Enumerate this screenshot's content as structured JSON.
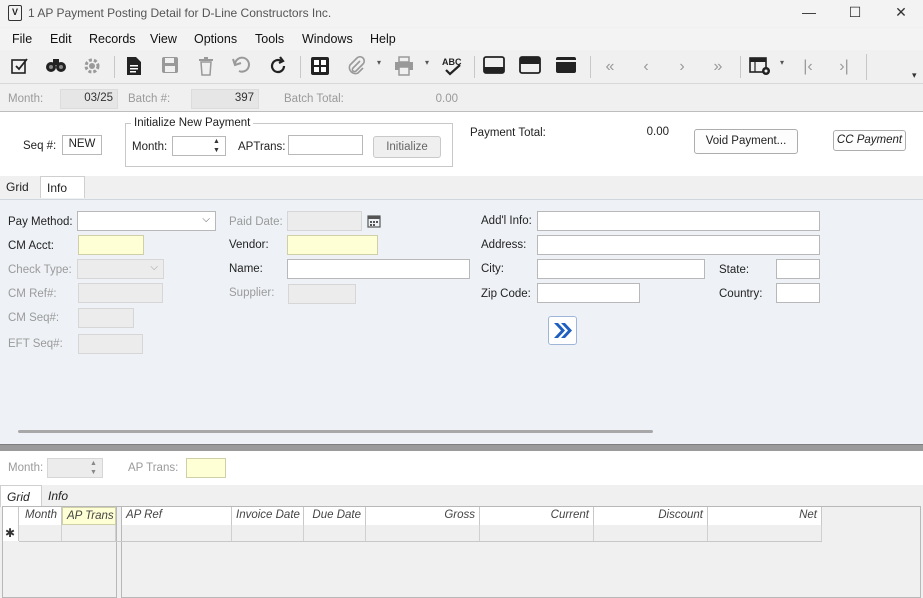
{
  "window": {
    "title": "1 AP Payment Posting Detail for D-Line Constructors Inc.",
    "app_icon_text": "V",
    "minimize": "—",
    "maximize": "☐",
    "close": "✕"
  },
  "menu": [
    "File",
    "Edit",
    "Records",
    "View",
    "Options",
    "Tools",
    "Windows",
    "Help"
  ],
  "batch": {
    "month_label": "Month:",
    "month_value": "03/25",
    "batch_label": "Batch #:",
    "batch_value": "397",
    "total_label": "Batch Total:",
    "total_value": "0.00"
  },
  "init": {
    "seq_label": "Seq #:",
    "seq_value": "NEW",
    "group_title": "Initialize New Payment",
    "month_label": "Month:",
    "month_value": "",
    "aptrans_label": "APTrans:",
    "aptrans_value": "",
    "initialize_button": "Initialize",
    "payment_total_label": "Payment Total:",
    "payment_total_value": "0.00",
    "void_button": "Void Payment...",
    "cc_button": "CC Payment"
  },
  "upper_tabs": [
    "Grid",
    "Info"
  ],
  "info": {
    "pay_method_label": "Pay Method:",
    "pay_method_value": "",
    "cm_acct_label": "CM Acct:",
    "check_type_label": "Check Type:",
    "cm_ref_label": "CM Ref#:",
    "cm_seq_label": "CM Seq#:",
    "eft_seq_label": "EFT Seq#:",
    "paid_date_label": "Paid Date:",
    "vendor_label": "Vendor:",
    "name_label": "Name:",
    "supplier_label": "Supplier:",
    "addl_info_label": "Add'l Info:",
    "address_label": "Address:",
    "city_label": "City:",
    "state_label": "State:",
    "zip_label": "Zip Code:",
    "country_label": "Country:"
  },
  "lower": {
    "month_label": "Month:",
    "aptrans_label": "AP Trans:"
  },
  "lower_tabs": [
    "Grid",
    "Info"
  ],
  "grid": {
    "new_row_marker": "✱",
    "columns": [
      "Month",
      "AP Trans",
      "AP Ref",
      "Invoice Date",
      "Due Date",
      "Gross",
      "Current",
      "Discount",
      "Net"
    ]
  }
}
